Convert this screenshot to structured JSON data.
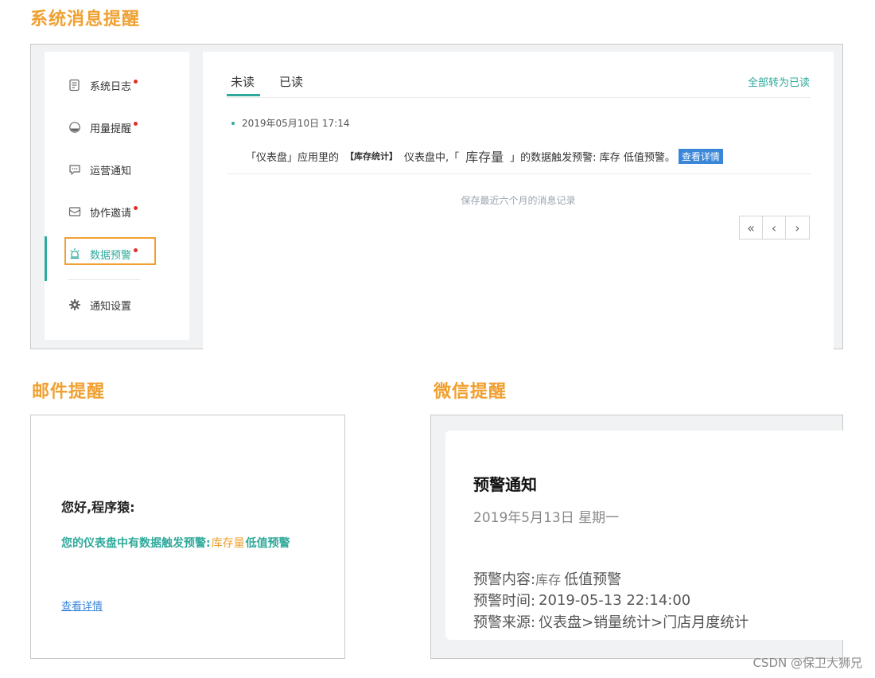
{
  "sections": {
    "system": "系统消息提醒",
    "mail": "邮件提醒",
    "wechat": "微信提醒"
  },
  "sidebar": {
    "items": [
      {
        "label": "系统日志",
        "icon": "document-icon",
        "unread": true
      },
      {
        "label": "用量提醒",
        "icon": "gauge-icon",
        "unread": true
      },
      {
        "label": "运营通知",
        "icon": "chat-icon",
        "unread": false
      },
      {
        "label": "协作邀请",
        "icon": "envelope-icon",
        "unread": true
      },
      {
        "label": "数据预警",
        "icon": "alarm-icon",
        "unread": true,
        "active": true
      },
      {
        "label": "通知设置",
        "icon": "gear-icon",
        "unread": false
      }
    ]
  },
  "content": {
    "tabs": [
      "未读",
      "已读"
    ],
    "active_tab": "未读",
    "mark_all_read": "全部转为已读",
    "message": {
      "time": "2019年05月10日 17:14",
      "prefix": "「仪表盘」应用里的",
      "dashboard_name": "【库存统计】",
      "mid": "仪表盘中,「",
      "field": "库存量",
      "suffix": "」的数据触发预警: 库存 低值预警。",
      "detail_button": "查看详情"
    },
    "keep_note": "保存最近六个月的消息记录",
    "pager": {
      "first": "«",
      "prev": "‹",
      "next": "›"
    }
  },
  "mail": {
    "greeting": "您好,程序猿:",
    "body_prefix": "您的仪表盘中有数据触发预警:",
    "field": "库存量",
    "body_suffix": "低值预警",
    "link": "查看详情"
  },
  "wechat": {
    "title": "预警通知",
    "date": "2019年5月13日 星期一",
    "content_label": "预警内容:",
    "content_field": "库存",
    "content_value": "低值预警",
    "time_label": "预警时间:",
    "time_value": "2019-05-13 22:14:00",
    "source_label": "预警来源:",
    "source_value": "仪表盘>销量统计>门店月度统计"
  },
  "watermark": "CSDN @保卫大狮兄",
  "colors": {
    "accent": "#2fa99b",
    "highlight": "#f0a030",
    "unread_dot": "#e0302a",
    "link": "#3a86d8"
  }
}
